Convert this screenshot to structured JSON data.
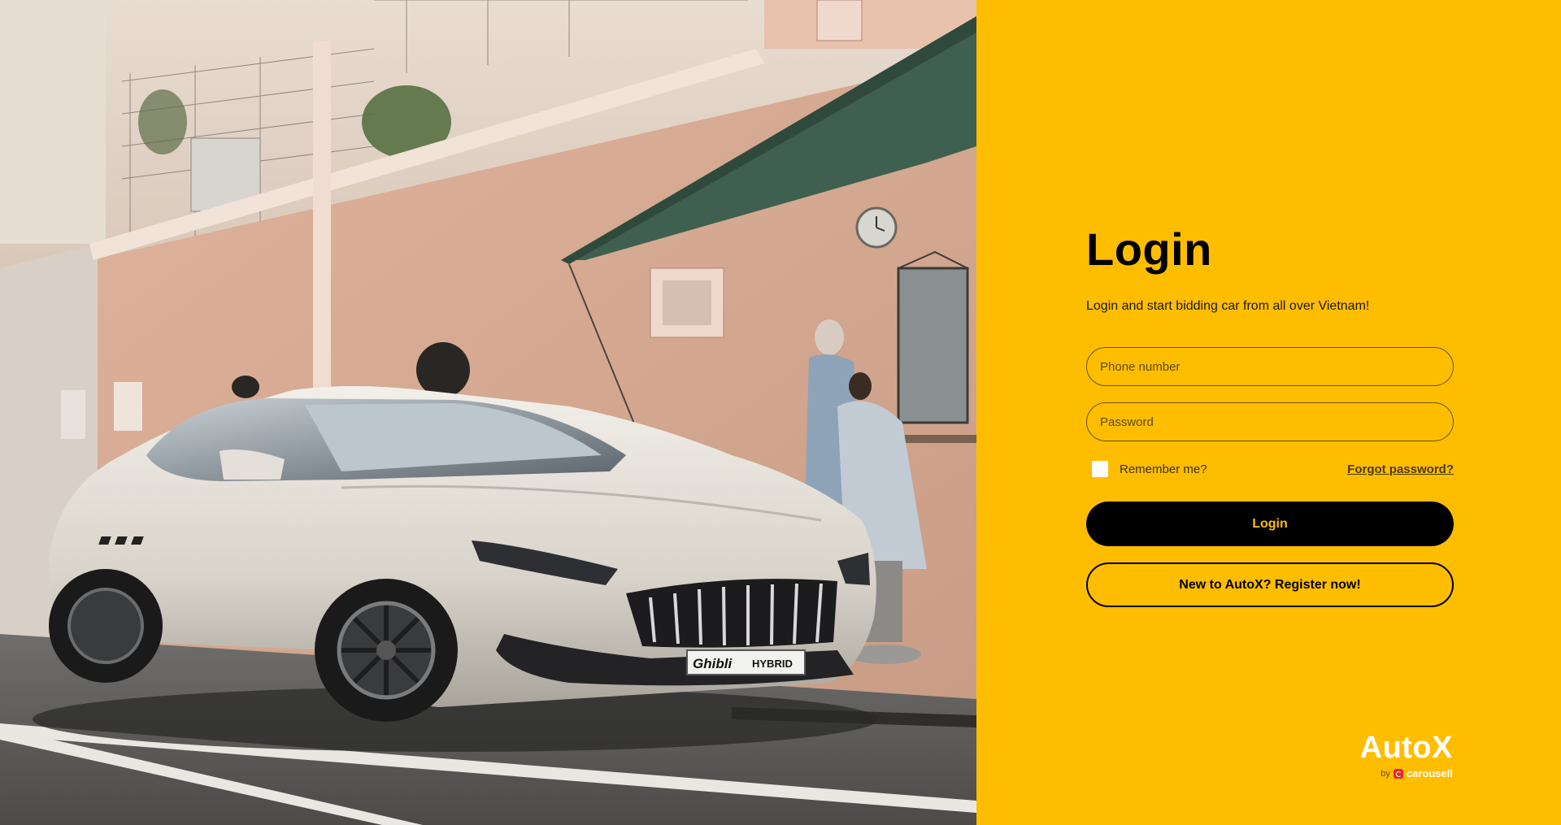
{
  "login": {
    "title": "Login",
    "subtitle": "Login and start bidding car from all over Vietnam!",
    "phone_placeholder": "Phone number",
    "password_placeholder": "Password",
    "remember_label": "Remember me?",
    "forgot_label": "Forgot password?",
    "login_button": "Login",
    "register_button": "New to AutoX? Register now!"
  },
  "brand": {
    "name": "AutoX",
    "by": "by",
    "partner": "carousell"
  },
  "car_plate": {
    "model": "Ghibli",
    "variant": "HYBRID"
  },
  "colors": {
    "accent": "#ffbd00",
    "button": "#000000",
    "partner_red": "#e3262b"
  }
}
